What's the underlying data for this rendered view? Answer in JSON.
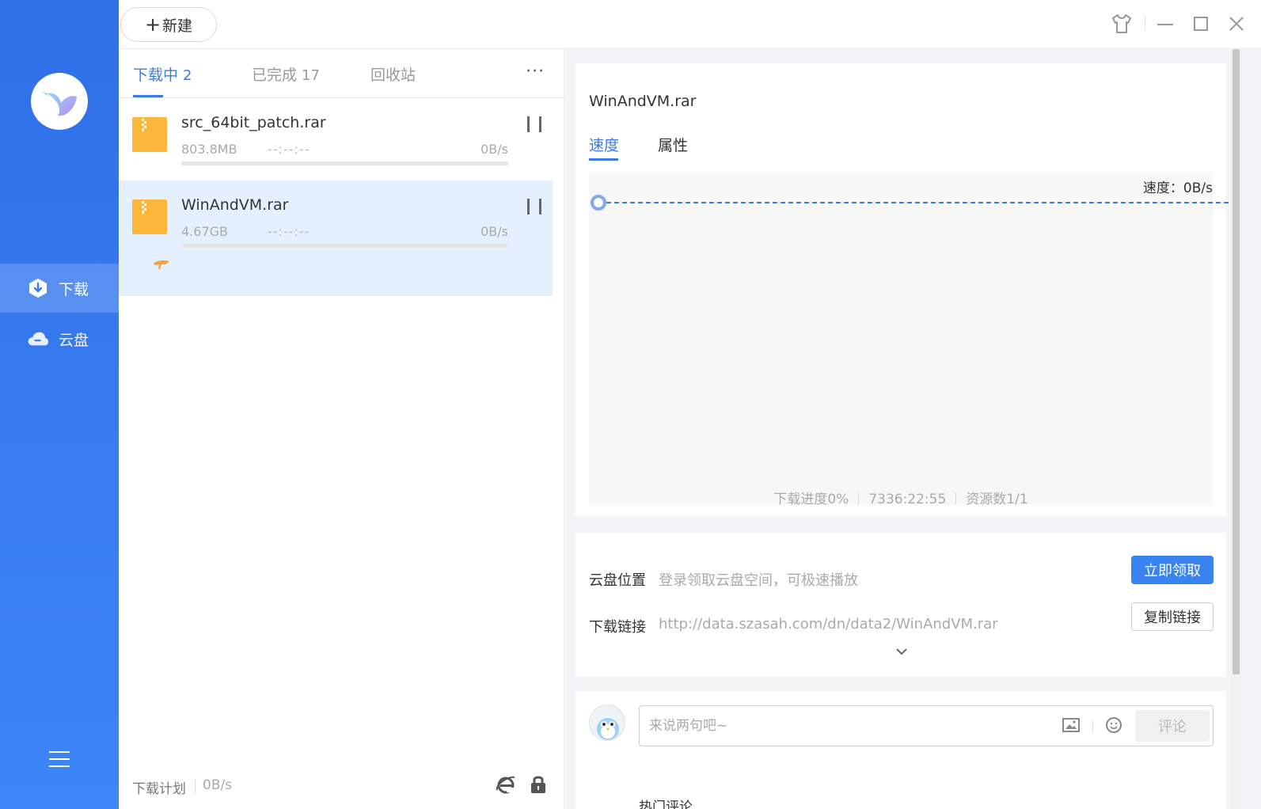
{
  "sidebar": {
    "nav": [
      {
        "label": "下载",
        "icon": "download-shield-icon",
        "active": true
      },
      {
        "label": "云盘",
        "icon": "cloud-icon",
        "active": false
      }
    ]
  },
  "toolbar": {
    "new_label": "新建"
  },
  "list": {
    "tabs": [
      {
        "label": "下载中",
        "count": "2",
        "active": true
      },
      {
        "label": "已完成",
        "count": "17",
        "active": false
      },
      {
        "label": "回收站",
        "count": "",
        "active": false
      }
    ],
    "more_label": "···",
    "tasks": [
      {
        "name": "src_64bit_patch.rar",
        "size": "803.8MB",
        "eta": "--:--:--",
        "speed": "0B/s",
        "progress": 0
      },
      {
        "name": "WinAndVM.rar",
        "size": "4.67GB",
        "eta": "--:--:--",
        "speed": "0B/s",
        "progress": 0
      }
    ],
    "footer": {
      "plan_label": "下载计划",
      "speed": "0B/s"
    }
  },
  "detail": {
    "title": "WinAndVM.rar",
    "tabs": [
      {
        "label": "速度",
        "active": true
      },
      {
        "label": "属性",
        "active": false
      }
    ],
    "speed_readout": "速度：0B/s",
    "stats": {
      "progress": "下载进度0%",
      "time": "7336:22:55",
      "sources": "资源数1/1"
    },
    "cloud": {
      "location_label": "云盘位置",
      "location_value": "登录领取云盘空间，可极速播放",
      "claim_label": "立即领取",
      "link_label": "下载链接",
      "link_value": "http://data.szasah.com/dn/data2/WinAndVM.rar",
      "copy_label": "复制链接"
    },
    "comment": {
      "placeholder": "来说两句吧~",
      "submit_label": "评论",
      "peek": "热门评论"
    }
  },
  "colors": {
    "accent": "#3a7bea",
    "sidebar_top": "#2f6fe8",
    "sidebar_bottom": "#3d86f7",
    "file_icon": "#fbb63b",
    "selected_row": "#e5f0fe"
  }
}
